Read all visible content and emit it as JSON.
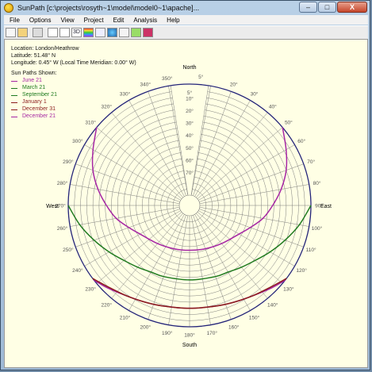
{
  "window": {
    "title": "SunPath [c:\\projects\\rosyth~1\\model\\model0~1\\apache]..."
  },
  "caption_buttons": {
    "minimize": "–",
    "maximize": "□",
    "close": "X"
  },
  "menu": [
    "File",
    "Options",
    "View",
    "Project",
    "Edit",
    "Analysis",
    "Help"
  ],
  "toolbar": [
    "new-icon",
    "open-icon",
    "print-icon",
    "print-preview-icon",
    "frame-icon",
    "3d-icon",
    "color-bars-icon",
    "report-icon",
    "globe-icon",
    "copy-icon",
    "export-icon",
    "book-icon"
  ],
  "info": {
    "location": "Location: London/Heathrow",
    "latitude": "Latitude: 51.48° N",
    "longitude": "Longitude: 0.45° W (Local Time Meridian: 0.00° W)"
  },
  "legend": {
    "heading": "Sun Paths Shown:",
    "items": [
      {
        "label": "June 21",
        "color": "#a626a4"
      },
      {
        "label": "March 21",
        "color": "#1f7a1f"
      },
      {
        "label": "September 21",
        "color": "#1f7a1f"
      },
      {
        "label": "January 1",
        "color": "#8b1c1c"
      },
      {
        "label": "December 31",
        "color": "#8b1c1c"
      },
      {
        "label": "December 21",
        "color": "#a626a4"
      }
    ]
  },
  "chart_data": {
    "type": "polar-sunpath",
    "directions": {
      "north": "North",
      "south": "South",
      "east": "East",
      "west": "West"
    },
    "azimuth_labels": [
      "5°",
      "20°",
      "30°",
      "40°",
      "50°",
      "60°",
      "70°",
      "80°",
      "90°",
      "100°",
      "110°",
      "120°",
      "130°",
      "140°",
      "150°",
      "160°",
      "170°",
      "180°",
      "190°",
      "200°",
      "210°",
      "220°",
      "230°",
      "240°",
      "250°",
      "260°",
      "270°",
      "280°",
      "290°",
      "300°",
      "310°",
      "320°",
      "330°",
      "340°",
      "350°"
    ],
    "azimuth_values": [
      5,
      20,
      30,
      40,
      50,
      60,
      70,
      80,
      90,
      100,
      110,
      120,
      130,
      140,
      150,
      160,
      170,
      180,
      190,
      200,
      210,
      220,
      230,
      240,
      250,
      260,
      270,
      280,
      290,
      300,
      310,
      320,
      330,
      340,
      350
    ],
    "altitude_labels": [
      "5°",
      "10°",
      "20°",
      "30°",
      "40°",
      "50°",
      "60°",
      "70°"
    ],
    "altitude_values": [
      5,
      10,
      20,
      30,
      40,
      50,
      60,
      70
    ],
    "series": [
      {
        "name": "June 21",
        "color": "#a626a4",
        "points": [
          [
            50,
            0
          ],
          [
            60,
            8
          ],
          [
            70,
            15
          ],
          [
            80,
            23
          ],
          [
            90,
            31
          ],
          [
            100,
            38
          ],
          [
            110,
            46
          ],
          [
            120,
            52
          ],
          [
            140,
            58
          ],
          [
            160,
            61
          ],
          [
            180,
            62
          ],
          [
            200,
            61
          ],
          [
            220,
            58
          ],
          [
            240,
            52
          ],
          [
            250,
            46
          ],
          [
            260,
            38
          ],
          [
            270,
            31
          ],
          [
            280,
            23
          ],
          [
            290,
            15
          ],
          [
            300,
            8
          ],
          [
            310,
            0
          ]
        ]
      },
      {
        "name": "March 21",
        "color": "#1f7a1f",
        "points": [
          [
            90,
            0
          ],
          [
            100,
            8
          ],
          [
            110,
            16
          ],
          [
            120,
            23
          ],
          [
            130,
            29
          ],
          [
            140,
            33
          ],
          [
            150,
            36
          ],
          [
            160,
            37
          ],
          [
            180,
            38
          ],
          [
            200,
            37
          ],
          [
            210,
            36
          ],
          [
            220,
            33
          ],
          [
            230,
            29
          ],
          [
            240,
            23
          ],
          [
            250,
            16
          ],
          [
            260,
            8
          ],
          [
            270,
            0
          ]
        ]
      },
      {
        "name": "December 21",
        "color": "#a626a4",
        "points": [
          [
            128,
            0
          ],
          [
            135,
            4
          ],
          [
            145,
            9
          ],
          [
            155,
            12
          ],
          [
            165,
            14
          ],
          [
            180,
            15
          ],
          [
            195,
            14
          ],
          [
            205,
            12
          ],
          [
            215,
            9
          ],
          [
            225,
            4
          ],
          [
            232,
            0
          ]
        ]
      },
      {
        "name": "January 1",
        "color": "#8b1c1c",
        "points": [
          [
            127,
            0
          ],
          [
            135,
            5
          ],
          [
            145,
            9
          ],
          [
            155,
            12
          ],
          [
            165,
            14
          ],
          [
            180,
            15
          ],
          [
            195,
            14
          ],
          [
            205,
            12
          ],
          [
            215,
            9
          ],
          [
            225,
            5
          ],
          [
            233,
            0
          ]
        ]
      }
    ]
  }
}
